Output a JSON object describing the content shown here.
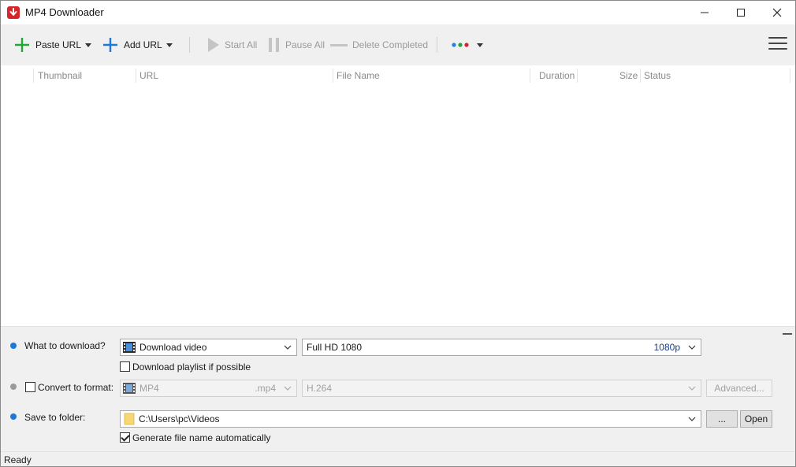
{
  "window": {
    "title": "MP4 Downloader",
    "icons": {
      "app": "download-arrow-icon",
      "minimize": "minimize-icon",
      "maximize": "maximize-icon",
      "close": "close-icon"
    }
  },
  "toolbar": {
    "paste_url": "Paste URL",
    "add_url": "Add URL",
    "start_all": "Start All",
    "pause_all": "Pause All",
    "delete_completed": "Delete Completed",
    "theme_dots_colors": [
      "#2a7de1",
      "#23a33a",
      "#d0262c"
    ],
    "accent_green": "#1ea83a",
    "accent_blue": "#1e78d7"
  },
  "table": {
    "columns": [
      "Thumbnail",
      "URL",
      "File Name",
      "Duration",
      "Size",
      "Status"
    ],
    "rows": []
  },
  "options": {
    "what_to_download": {
      "label": "What to download?",
      "type_value": "Download video",
      "quality_value": "Full HD 1080",
      "quality_tag": "1080p",
      "playlist_checkbox_label": "Download playlist if possible",
      "playlist_checked": false
    },
    "convert": {
      "label": "Convert to format:",
      "checked": false,
      "format_value": "MP4",
      "format_ext": ".mp4",
      "codec_value": "H.264",
      "advanced_label": "Advanced..."
    },
    "save": {
      "label": "Save to folder:",
      "folder_value": "C:\\Users\\pc\\Videos",
      "browse_label": "...",
      "open_label": "Open",
      "auto_name_label": "Generate file name automatically",
      "auto_name_checked": true
    }
  },
  "status": {
    "text": "Ready"
  }
}
